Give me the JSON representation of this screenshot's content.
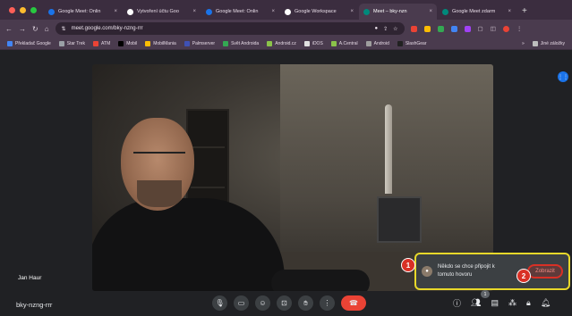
{
  "browser": {
    "tabs": [
      {
        "title": "Google Meet: Onlin",
        "color": "#1a73e8",
        "active": false
      },
      {
        "title": "Vytvoření účtu Goo",
        "color": "#ffffff",
        "active": false
      },
      {
        "title": "Google Meet: Onlin",
        "color": "#1a73e8",
        "active": false
      },
      {
        "title": "Google Workspace",
        "color": "#ffffff",
        "active": false
      },
      {
        "title": "Meet – bky-nzn",
        "color": "#00897b",
        "active": true
      },
      {
        "title": "Google Meet zdarm",
        "color": "#00897b",
        "active": false
      }
    ],
    "new_tab": "+",
    "close_glyph": "×",
    "url": "meet.google.com/bky-nzng-rrr",
    "bookmarks": [
      {
        "label": "Překladač Google",
        "color": "#4285f4"
      },
      {
        "label": "Star Trek",
        "color": "#9aa0a6"
      },
      {
        "label": "ATM",
        "color": "#ea4335"
      },
      {
        "label": "Mobil",
        "color": "#000000"
      },
      {
        "label": "MobilMania",
        "color": "#fbbc04"
      },
      {
        "label": "Palmserver",
        "color": "#3f51b5"
      },
      {
        "label": "Svět Androida",
        "color": "#34a853"
      },
      {
        "label": "Android.cz",
        "color": "#8bc34a"
      },
      {
        "label": "iDOS",
        "color": "#e0e0e0"
      },
      {
        "label": "A.Central",
        "color": "#8bc34a"
      },
      {
        "label": "Android",
        "color": "#9e9e9e"
      },
      {
        "label": "SlashGear",
        "color": "#212121"
      }
    ],
    "bookmarks_more": "»",
    "other_bookmarks": "Jiné záložky"
  },
  "meet": {
    "participant_name": "Jan Haur",
    "meeting_code": "bky-nzng-rrr",
    "notification": {
      "message": "Někdo se chce připojit k tomuto hovoru",
      "action": "Zobrazit",
      "step1": "1",
      "step2": "2"
    },
    "people_count": "1",
    "accent": "#1a73e8",
    "end_call_color": "#ea4335",
    "highlight_color": "#e8d82a"
  }
}
